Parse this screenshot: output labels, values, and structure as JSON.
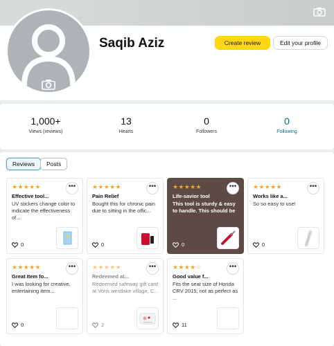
{
  "profile": {
    "name": "Saqib Aziz",
    "create_review_label": "Create review",
    "edit_profile_label": "Edit your profile"
  },
  "stats": [
    {
      "value": "1,000+",
      "label": "Views (reviews)"
    },
    {
      "value": "13",
      "label": "Hearts"
    },
    {
      "value": "0",
      "label": "Followers"
    },
    {
      "value": "0",
      "label": "Following"
    }
  ],
  "tabs": [
    "Reviews",
    "Posts"
  ],
  "reviews": [
    {
      "stars": "★★★★★",
      "title": "Effective tool...",
      "body": "UV stickers change color to indicate the effectiveness of...",
      "likes": "0",
      "thumb_icon": "uv-sticker-icon"
    },
    {
      "stars": "★★★★★",
      "title": "Pain Relief",
      "body": "Bought this for chronic pain due to sitting in the offic...",
      "likes": "0",
      "thumb_icon": "red-device-icon"
    },
    {
      "stars": "★★★★★",
      "title": "Life-savior tool",
      "body": "This tool is sturdy & easy to handle. This should be",
      "likes": "0",
      "thumb_icon": "red-tool-icon"
    },
    {
      "stars": "★★★★★",
      "title": "Works like a...",
      "body": "So so easy to use!",
      "likes": "0",
      "thumb_icon": "white-device-icon"
    },
    {
      "stars": "★★★★★",
      "title": "Great Item fo...",
      "body": "I was looking for creative, entertaining item...",
      "likes": "0",
      "thumb_icon": "empty-thumb"
    },
    {
      "stars": "★★★★★",
      "title": "Redeemed at...",
      "body": "Redeemed safeway gift card at Vons westlake village, C...",
      "likes": "2",
      "thumb_icon": "gift-card-icon"
    },
    {
      "stars": "★★★★☆",
      "title": "Good value f...",
      "body": "Fits the seat size of Honda CRV 2015; not as perfect as ...",
      "likes": "11",
      "thumb_icon": "empty-thumb"
    }
  ]
}
